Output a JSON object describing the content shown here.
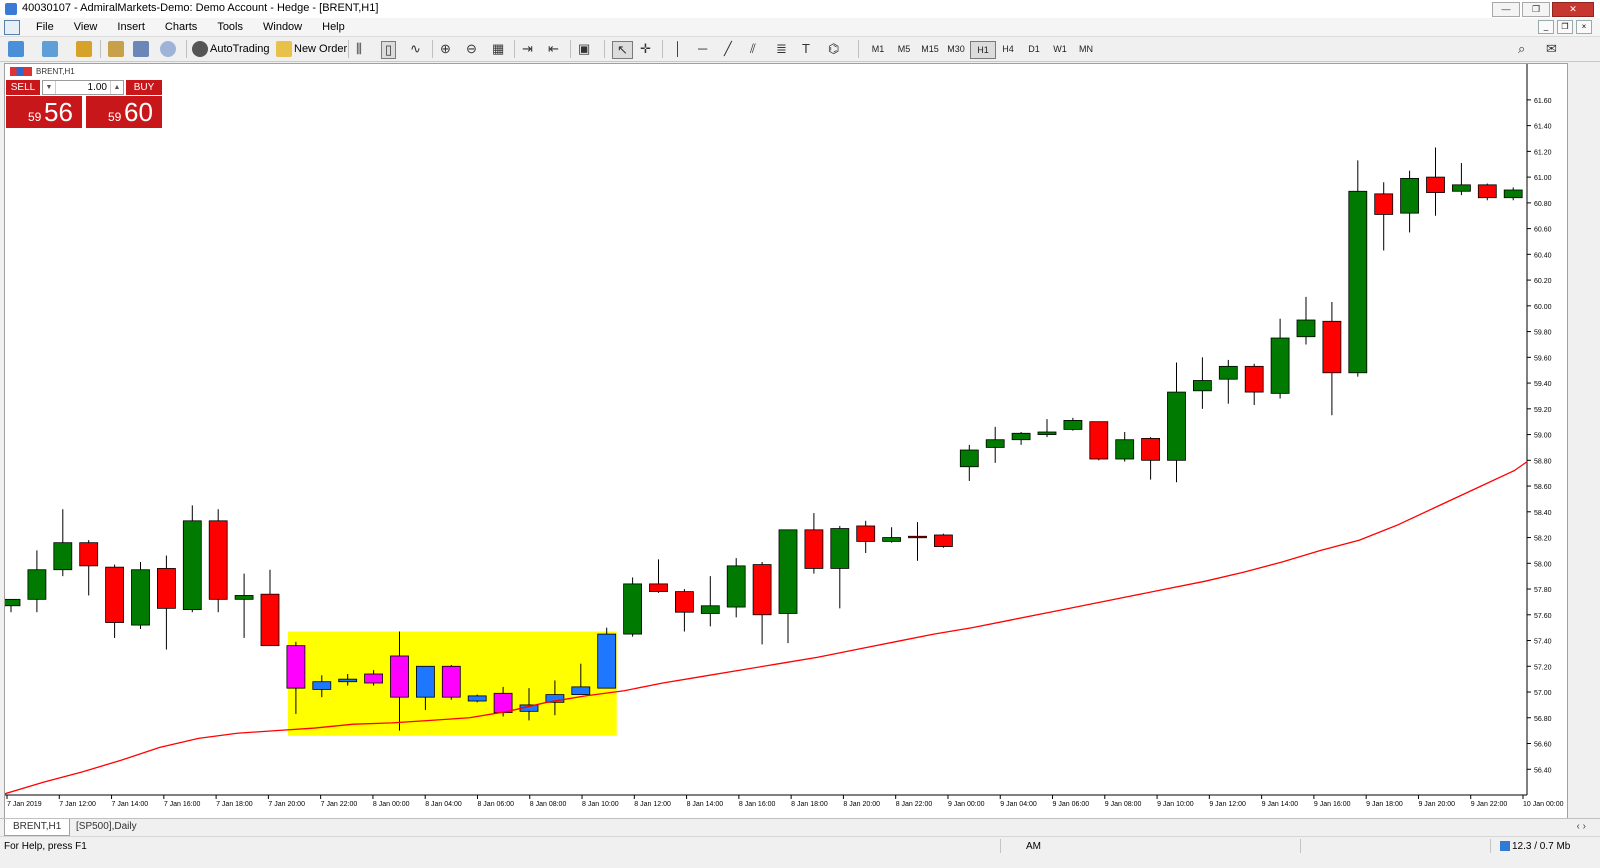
{
  "window": {
    "title": "40030107 - AdmiralMarkets-Demo: Demo Account - Hedge - [BRENT,H1]",
    "buttons": [
      "—",
      "❐",
      "✕"
    ]
  },
  "menu": {
    "items": [
      "File",
      "View",
      "Insert",
      "Charts",
      "Tools",
      "Window",
      "Help"
    ],
    "mdi_buttons": [
      "_",
      "❐",
      "×"
    ]
  },
  "toolbar": {
    "auto_trading": "AutoTrading",
    "new_order": "New Order",
    "timeframes": [
      "M1",
      "M5",
      "M15",
      "M30",
      "H1",
      "H4",
      "D1",
      "W1",
      "MN"
    ],
    "active_timeframe": "H1"
  },
  "trade_panel": {
    "sell_label": "SELL",
    "buy_label": "BUY",
    "lot": "1.00",
    "sell_small": "59",
    "sell_big": "56",
    "buy_small": "59",
    "buy_big": "60"
  },
  "chart_label": "BRENT,H1",
  "colors": {
    "bull": "#007a00",
    "bear": "#ff0000",
    "highlight_bull": "#1e78ff",
    "highlight_bear": "#ff00ff",
    "highlight_box": "#ffff00",
    "ma": "#ff0000",
    "sell_buy": "#c8171a"
  },
  "chart_data": {
    "type": "candlestick",
    "symbol": "BRENT",
    "timeframe": "H1",
    "ylim": [
      56.2,
      61.7
    ],
    "y_ticks": [
      "61.60",
      "61.40",
      "61.20",
      "61.00",
      "60.80",
      "60.60",
      "60.40",
      "60.20",
      "60.00",
      "59.80",
      "59.60",
      "59.40",
      "59.20",
      "59.00",
      "58.80",
      "58.60",
      "58.40",
      "58.20",
      "58.00",
      "57.80",
      "57.60",
      "57.40",
      "57.20",
      "57.00",
      "56.80",
      "56.60",
      "56.40"
    ],
    "x_labels": [
      "7 Jan 2019",
      "7 Jan 12:00",
      "7 Jan 14:00",
      "7 Jan 16:00",
      "7 Jan 18:00",
      "7 Jan 20:00",
      "7 Jan 22:00",
      "8 Jan 00:00",
      "8 Jan 04:00",
      "8 Jan 06:00",
      "8 Jan 08:00",
      "8 Jan 10:00",
      "8 Jan 12:00",
      "8 Jan 14:00",
      "8 Jan 16:00",
      "8 Jan 18:00",
      "8 Jan 20:00",
      "8 Jan 22:00",
      "9 Jan 00:00",
      "9 Jan 04:00",
      "9 Jan 06:00",
      "9 Jan 08:00",
      "9 Jan 10:00",
      "9 Jan 12:00",
      "9 Jan 14:00",
      "9 Jan 16:00",
      "9 Jan 18:00",
      "9 Jan 20:00",
      "9 Jan 22:00",
      "10 Jan 00:00"
    ],
    "candles": [
      {
        "o": 57.67,
        "h": 57.72,
        "l": 57.62,
        "c": 57.72
      },
      {
        "o": 57.72,
        "h": 58.1,
        "l": 57.62,
        "c": 57.95
      },
      {
        "o": 57.95,
        "h": 58.42,
        "l": 57.9,
        "c": 58.16
      },
      {
        "o": 58.16,
        "h": 58.18,
        "l": 57.75,
        "c": 57.98
      },
      {
        "o": 57.97,
        "h": 57.99,
        "l": 57.42,
        "c": 57.54
      },
      {
        "o": 57.52,
        "h": 58.01,
        "l": 57.49,
        "c": 57.95
      },
      {
        "o": 57.96,
        "h": 58.06,
        "l": 57.33,
        "c": 57.65
      },
      {
        "o": 57.64,
        "h": 58.45,
        "l": 57.62,
        "c": 58.33
      },
      {
        "o": 58.33,
        "h": 58.42,
        "l": 57.62,
        "c": 57.72
      },
      {
        "o": 57.72,
        "h": 57.92,
        "l": 57.42,
        "c": 57.75
      },
      {
        "o": 57.76,
        "h": 57.95,
        "l": 57.36,
        "c": 57.36
      },
      {
        "o": 57.36,
        "h": 57.39,
        "l": 56.83,
        "c": 57.03
      },
      {
        "o": 57.02,
        "h": 57.13,
        "l": 56.96,
        "c": 57.08
      },
      {
        "o": 57.08,
        "h": 57.14,
        "l": 57.05,
        "c": 57.1
      },
      {
        "o": 57.14,
        "h": 57.17,
        "l": 57.05,
        "c": 57.07
      },
      {
        "o": 57.28,
        "h": 57.47,
        "l": 56.7,
        "c": 56.96
      },
      {
        "o": 56.96,
        "h": 57.2,
        "l": 56.86,
        "c": 57.2
      },
      {
        "o": 57.2,
        "h": 57.21,
        "l": 56.94,
        "c": 56.96
      },
      {
        "o": 56.93,
        "h": 56.98,
        "l": 56.92,
        "c": 56.97
      },
      {
        "o": 56.99,
        "h": 57.04,
        "l": 56.81,
        "c": 56.84
      },
      {
        "o": 56.85,
        "h": 57.03,
        "l": 56.78,
        "c": 56.9
      },
      {
        "o": 56.92,
        "h": 57.09,
        "l": 56.82,
        "c": 56.98
      },
      {
        "o": 56.98,
        "h": 57.22,
        "l": 56.98,
        "c": 57.04
      },
      {
        "o": 57.03,
        "h": 57.5,
        "l": 57.03,
        "c": 57.45
      },
      {
        "o": 57.45,
        "h": 57.89,
        "l": 57.43,
        "c": 57.84
      },
      {
        "o": 57.84,
        "h": 58.03,
        "l": 57.77,
        "c": 57.78
      },
      {
        "o": 57.78,
        "h": 57.8,
        "l": 57.47,
        "c": 57.62
      },
      {
        "o": 57.61,
        "h": 57.9,
        "l": 57.51,
        "c": 57.67
      },
      {
        "o": 57.66,
        "h": 58.04,
        "l": 57.58,
        "c": 57.98
      },
      {
        "o": 57.99,
        "h": 58.01,
        "l": 57.37,
        "c": 57.6
      },
      {
        "o": 57.61,
        "h": 58.26,
        "l": 57.38,
        "c": 58.26
      },
      {
        "o": 58.26,
        "h": 58.39,
        "l": 57.92,
        "c": 57.96
      },
      {
        "o": 57.96,
        "h": 58.29,
        "l": 57.65,
        "c": 58.27
      },
      {
        "o": 58.29,
        "h": 58.33,
        "l": 58.08,
        "c": 58.17
      },
      {
        "o": 58.17,
        "h": 58.28,
        "l": 58.16,
        "c": 58.2
      },
      {
        "o": 58.21,
        "h": 58.32,
        "l": 58.02,
        "c": 58.2
      },
      {
        "o": 58.22,
        "h": 58.23,
        "l": 58.12,
        "c": 58.13
      },
      {
        "o": 58.75,
        "h": 58.92,
        "l": 58.64,
        "c": 58.88
      },
      {
        "o": 58.9,
        "h": 59.06,
        "l": 58.78,
        "c": 58.96
      },
      {
        "o": 58.96,
        "h": 59.02,
        "l": 58.92,
        "c": 59.01
      },
      {
        "o": 59.0,
        "h": 59.12,
        "l": 58.98,
        "c": 59.02
      },
      {
        "o": 59.04,
        "h": 59.13,
        "l": 59.03,
        "c": 59.11
      },
      {
        "o": 59.1,
        "h": 59.1,
        "l": 58.8,
        "c": 58.81
      },
      {
        "o": 58.81,
        "h": 59.02,
        "l": 58.79,
        "c": 58.96
      },
      {
        "o": 58.97,
        "h": 58.98,
        "l": 58.65,
        "c": 58.8
      },
      {
        "o": 58.8,
        "h": 59.56,
        "l": 58.63,
        "c": 59.33
      },
      {
        "o": 59.34,
        "h": 59.6,
        "l": 59.2,
        "c": 59.42
      },
      {
        "o": 59.43,
        "h": 59.58,
        "l": 59.24,
        "c": 59.53
      },
      {
        "o": 59.53,
        "h": 59.55,
        "l": 59.23,
        "c": 59.33
      },
      {
        "o": 59.32,
        "h": 59.9,
        "l": 59.28,
        "c": 59.75
      },
      {
        "o": 59.76,
        "h": 60.07,
        "l": 59.7,
        "c": 59.89
      },
      {
        "o": 59.88,
        "h": 60.03,
        "l": 59.15,
        "c": 59.48
      },
      {
        "o": 59.48,
        "h": 61.13,
        "l": 59.45,
        "c": 60.89
      },
      {
        "o": 60.87,
        "h": 60.96,
        "l": 60.43,
        "c": 60.71
      },
      {
        "o": 60.72,
        "h": 61.05,
        "l": 60.57,
        "c": 60.99
      },
      {
        "o": 61.0,
        "h": 61.23,
        "l": 60.7,
        "c": 60.88
      },
      {
        "o": 60.89,
        "h": 61.11,
        "l": 60.86,
        "c": 60.94
      },
      {
        "o": 60.94,
        "h": 60.95,
        "l": 60.82,
        "c": 60.84
      },
      {
        "o": 60.84,
        "h": 60.92,
        "l": 60.82,
        "c": 60.9
      }
    ],
    "highlight": {
      "from_index": 11,
      "to_index": 23,
      "low": 56.66,
      "high": 57.47
    },
    "moving_average": [
      [
        0,
        56.21
      ],
      [
        3,
        56.3
      ],
      [
        6,
        56.38
      ],
      [
        9,
        56.47
      ],
      [
        12,
        56.57
      ],
      [
        15,
        56.64
      ],
      [
        18,
        56.68
      ],
      [
        21,
        56.7
      ],
      [
        24,
        56.72
      ],
      [
        27,
        56.75
      ],
      [
        30,
        56.76
      ],
      [
        33,
        56.78
      ],
      [
        36,
        56.8
      ],
      [
        39,
        56.85
      ],
      [
        42,
        56.92
      ],
      [
        45,
        56.97
      ],
      [
        48,
        57.01
      ],
      [
        51,
        57.07
      ],
      [
        54,
        57.12
      ],
      [
        57,
        57.17
      ],
      [
        60,
        57.22
      ],
      [
        63,
        57.27
      ],
      [
        66,
        57.33
      ],
      [
        69,
        57.39
      ],
      [
        72,
        57.45
      ],
      [
        75,
        57.5
      ],
      [
        78,
        57.56
      ],
      [
        81,
        57.62
      ],
      [
        84,
        57.68
      ],
      [
        87,
        57.74
      ],
      [
        90,
        57.8
      ],
      [
        93,
        57.86
      ],
      [
        96,
        57.93
      ],
      [
        99,
        58.01
      ],
      [
        102,
        58.1
      ],
      [
        105,
        58.18
      ],
      [
        108,
        58.3
      ],
      [
        111,
        58.44
      ],
      [
        114,
        58.58
      ],
      [
        117,
        58.72
      ],
      [
        118,
        58.79
      ]
    ]
  },
  "tabs": [
    "BRENT,H1",
    "[SP500],Daily"
  ],
  "tab_arrows": "‹ ›",
  "status": {
    "help": "For Help, press F1",
    "middle": "AM",
    "right": "12.3 / 0.7 Mb"
  }
}
